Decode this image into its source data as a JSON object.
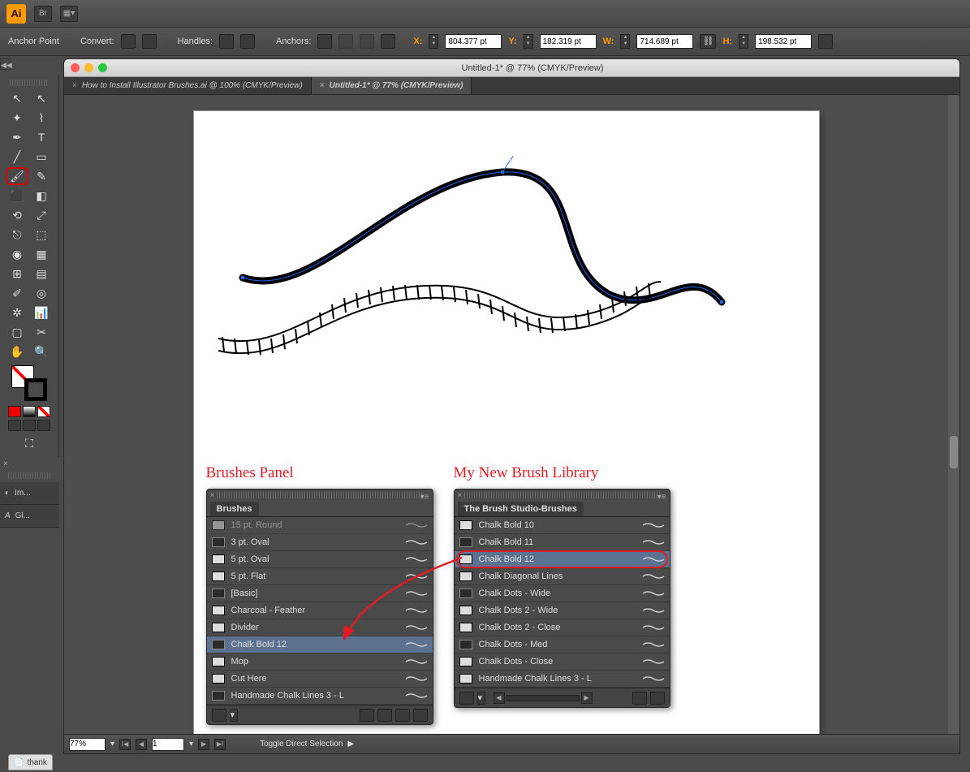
{
  "appbar": {
    "logo": "Ai",
    "br": "Br"
  },
  "controlbar": {
    "anchor_label": "Anchor Point",
    "convert_label": "Convert:",
    "handles_label": "Handles:",
    "anchors_label": "Anchors:",
    "x_label": "X:",
    "x_val": "804.377 pt",
    "y_label": "Y:",
    "y_val": "182.319 pt",
    "w_label": "W:",
    "w_val": "714.689 pt",
    "h_label": "H:",
    "h_val": "198.532 pt"
  },
  "window_title": "Untitled-1* @ 77% (CMYK/Preview)",
  "doc_tabs": [
    {
      "label": "How to Install Illustrator Brushes.ai @ 100% (CMYK/Preview)",
      "active": false
    },
    {
      "label": "Untitled-1* @ 77% (CMYK/Preview)",
      "active": true
    }
  ],
  "left_dock": [
    {
      "label": "Im..."
    },
    {
      "label": "Gl..."
    }
  ],
  "annotations": {
    "brushes_panel": "Brushes Panel",
    "library": "My New Brush Library"
  },
  "brushes_panel": {
    "title": "Brushes",
    "items": [
      {
        "label": "15 pt. Round",
        "dim": true
      },
      {
        "label": "3 pt. Oval"
      },
      {
        "label": "5 pt. Oval"
      },
      {
        "label": "5 pt. Flat"
      },
      {
        "label": "[Basic]"
      },
      {
        "label": "Charcoal - Feather"
      },
      {
        "label": "Divider"
      },
      {
        "label": "Chalk Bold 12",
        "selected": true
      },
      {
        "label": "Mop"
      },
      {
        "label": "Cut Here"
      },
      {
        "label": "Handmade Chalk Lines 3 - L"
      }
    ]
  },
  "library_panel": {
    "title": "The Brush Studio-Brushes",
    "items": [
      {
        "label": "Chalk Bold 10"
      },
      {
        "label": "Chalk Bold 11"
      },
      {
        "label": "Chalk Bold 12",
        "selected": true,
        "circled": true
      },
      {
        "label": "Chalk Diagonal Lines"
      },
      {
        "label": "Chalk Dots - Wide"
      },
      {
        "label": "Chalk Dots 2 - Wide"
      },
      {
        "label": "Chalk Dots 2 - Close"
      },
      {
        "label": "Chalk Dots - Med"
      },
      {
        "label": "Chalk Dots - Close"
      },
      {
        "label": "Handmade Chalk Lines 3 - L"
      }
    ]
  },
  "status": {
    "zoom": "77%",
    "page": "1",
    "mode": "Toggle Direct Selection"
  },
  "os_thumb": "thank"
}
